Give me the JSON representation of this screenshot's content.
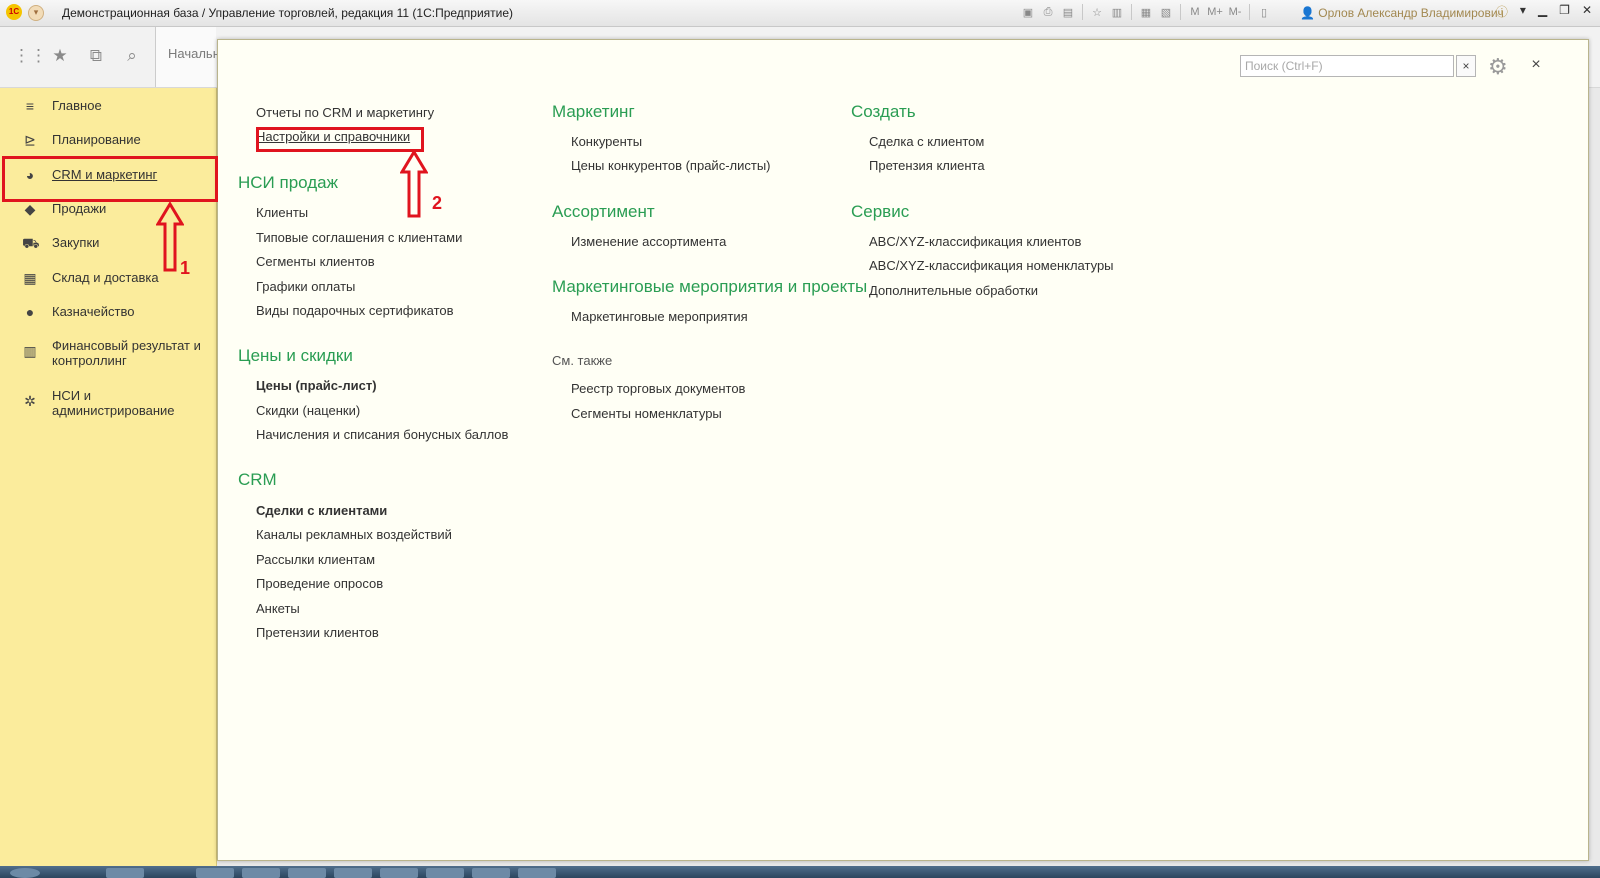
{
  "window": {
    "title": "Демонстрационная база / Управление торговлей, редакция 11  (1С:Предприятие)",
    "logo_text": "1С",
    "user": "Орлов Александр Владимирович",
    "toolbar_icons": [
      "save-icon",
      "print-icon",
      "preview-icon",
      "favorite-icon",
      "history-icon",
      "calc-icon",
      "calendar-icon",
      "m-icon",
      "m-plus-icon",
      "m-minus-icon",
      "fullscreen-icon",
      "user-icon",
      "info-icon"
    ],
    "memory_buttons": [
      "M",
      "M+",
      "M-"
    ]
  },
  "app_toolbar": {
    "start_tab": "Начальн"
  },
  "sidebar": {
    "items": [
      {
        "label": "Главное",
        "icon": "menu-icon"
      },
      {
        "label": "Планирование",
        "icon": "planning-icon"
      },
      {
        "label": "CRM и маркетинг",
        "icon": "pie-chart-icon"
      },
      {
        "label": "Продажи",
        "icon": "bag-icon"
      },
      {
        "label": "Закупки",
        "icon": "cart-icon"
      },
      {
        "label": "Склад и доставка",
        "icon": "warehouse-icon"
      },
      {
        "label": "Казначейство",
        "icon": "ruble-icon"
      },
      {
        "label": "Финансовый результат и контроллинг",
        "icon": "bar-chart-icon"
      },
      {
        "label": "НСИ и администрирование",
        "icon": "gear-icon"
      }
    ]
  },
  "annotations": {
    "marker1": "1",
    "marker2": "2"
  },
  "panel": {
    "search_placeholder": "Поиск (Ctrl+F)",
    "search_clear": "×",
    "close": "×",
    "col1": {
      "top_links": [
        "Отчеты по CRM и маркетингу",
        "Настройки и справочники"
      ],
      "nsi_head": "НСИ продаж",
      "nsi_links": [
        "Клиенты",
        "Типовые соглашения с клиентами",
        "Сегменты клиентов",
        "Графики оплаты",
        "Виды подарочных сертификатов"
      ],
      "prices_head": "Цены и скидки",
      "prices_links": [
        "Цены (прайс-лист)",
        "Скидки (наценки)",
        "Начисления и списания бонусных баллов"
      ],
      "crm_head": "CRM",
      "crm_links": [
        "Сделки с клиентами",
        "Каналы рекламных воздействий",
        "Рассылки клиентам",
        "Проведение опросов",
        "Анкеты",
        "Претензии клиентов"
      ]
    },
    "col2": {
      "marketing_head": "Маркетинг",
      "marketing_links": [
        "Конкуренты",
        "Цены конкурентов (прайс-листы)"
      ],
      "assort_head": "Ассортимент",
      "assort_links": [
        "Изменение ассортимента"
      ],
      "events_head": "Маркетинговые мероприятия и проекты",
      "events_links": [
        "Маркетинговые мероприятия"
      ],
      "see_also": "См. также",
      "see_also_links": [
        "Реестр торговых документов",
        "Сегменты номенклатуры"
      ]
    },
    "col3": {
      "create_head": "Создать",
      "create_links": [
        "Сделка с клиентом",
        "Претензия клиента"
      ],
      "service_head": "Сервис",
      "service_links": [
        "ABC/XYZ-классификация клиентов",
        "ABC/XYZ-классификация номенклатуры",
        "Дополнительные обработки"
      ]
    }
  }
}
